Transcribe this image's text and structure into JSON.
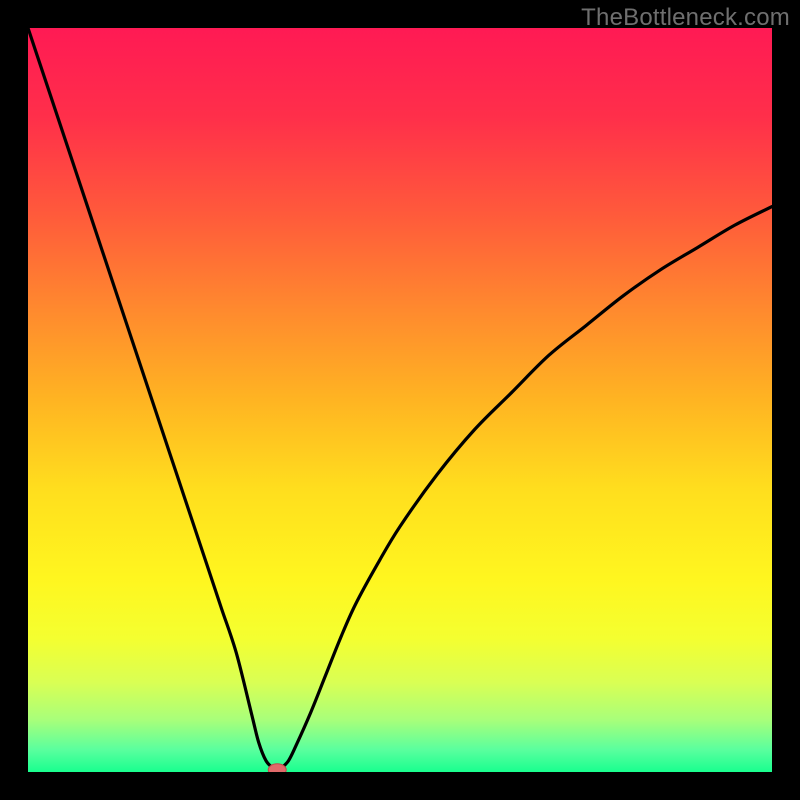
{
  "watermark": {
    "text": "TheBottleneck.com"
  },
  "chart_data": {
    "type": "line",
    "title": "",
    "xlabel": "",
    "ylabel": "",
    "xlim": [
      0,
      100
    ],
    "ylim": [
      0,
      100
    ],
    "x": [
      0,
      2,
      4,
      6,
      8,
      10,
      12,
      14,
      16,
      18,
      20,
      22,
      24,
      26,
      28,
      30,
      31,
      32,
      33,
      33.5,
      34,
      35,
      36,
      38,
      40,
      42,
      44,
      47,
      50,
      55,
      60,
      65,
      70,
      75,
      80,
      85,
      90,
      95,
      100
    ],
    "values": [
      100,
      94,
      88,
      82,
      76,
      70,
      64,
      58,
      52,
      46,
      40,
      34,
      28,
      22,
      16,
      8,
      4,
      1.5,
      0.5,
      0.3,
      0.5,
      1.5,
      3.5,
      8,
      13,
      18,
      22.5,
      28,
      33,
      40,
      46,
      51,
      56,
      60,
      64,
      67.5,
      70.5,
      73.5,
      76
    ],
    "marker": {
      "x": 33.5,
      "y": 0.3
    },
    "grid": false,
    "gradient_bands": [
      {
        "pos": 0.0,
        "color": "#ff1a54"
      },
      {
        "pos": 0.12,
        "color": "#ff2f4a"
      },
      {
        "pos": 0.25,
        "color": "#ff5a3b"
      },
      {
        "pos": 0.38,
        "color": "#ff8a2e"
      },
      {
        "pos": 0.5,
        "color": "#ffb422"
      },
      {
        "pos": 0.62,
        "color": "#ffde1e"
      },
      {
        "pos": 0.74,
        "color": "#fff61f"
      },
      {
        "pos": 0.82,
        "color": "#f4ff30"
      },
      {
        "pos": 0.88,
        "color": "#d9ff54"
      },
      {
        "pos": 0.93,
        "color": "#a8ff7a"
      },
      {
        "pos": 0.97,
        "color": "#5aff9e"
      },
      {
        "pos": 1.0,
        "color": "#19ff8f"
      }
    ]
  }
}
